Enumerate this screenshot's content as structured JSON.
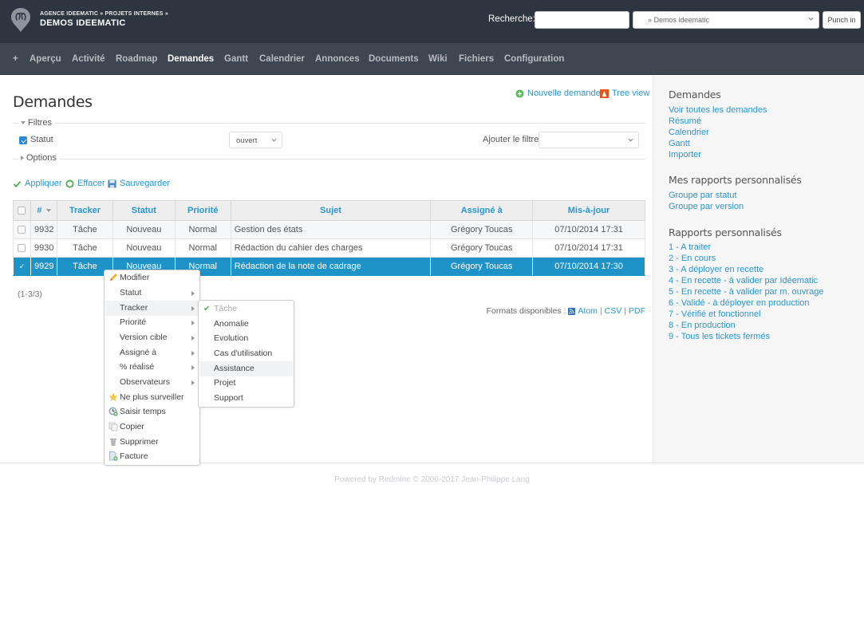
{
  "header": {
    "breadcrumb": "AGENCE IDEEMATIC » PROJETS INTERNES »",
    "project_title": "DEMOS IDEEMATIC",
    "search_label": "Recherche:",
    "search_value": "",
    "project_select_value": "» Demos ideematic",
    "punch_in_label": "Punch in"
  },
  "menu": {
    "items": [
      {
        "label": "+",
        "active": false
      },
      {
        "label": "Aperçu",
        "active": false
      },
      {
        "label": "Activité",
        "active": false
      },
      {
        "label": "Roadmap",
        "active": false
      },
      {
        "label": "Demandes",
        "active": true
      },
      {
        "label": "Gantt",
        "active": false
      },
      {
        "label": "Calendrier",
        "active": false
      },
      {
        "label": "Annonces",
        "active": false
      },
      {
        "label": "Documents",
        "active": false
      },
      {
        "label": "Wiki",
        "active": false
      },
      {
        "label": "Fichiers",
        "active": false
      },
      {
        "label": "Configuration",
        "active": false
      }
    ]
  },
  "content": {
    "title": "Demandes",
    "new_issue_label": "Nouvelle demande",
    "tree_view_label": "Tree view",
    "filters_legend": "Filtres",
    "options_legend": "Options",
    "status_filter": {
      "label": "Statut",
      "checked": true,
      "operator": "ouvert"
    },
    "add_filter_label": "Ajouter le filtre",
    "add_filter_value": "",
    "actions": {
      "apply": "Appliquer",
      "clear": "Effacer",
      "save": "Sauvegarder"
    },
    "pagination": "(1-3/3)",
    "formats_label": "Formats disponibles :",
    "formats": [
      "Atom",
      "CSV",
      "PDF"
    ]
  },
  "table": {
    "columns": [
      "#",
      "Tracker",
      "Statut",
      "Priorité",
      "Sujet",
      "Assigné à",
      "Mis-à-jour"
    ],
    "rows": [
      {
        "id": "9932",
        "tracker": "Tâche",
        "status": "Nouveau",
        "priority": "Normal",
        "subject": "Gestion des états",
        "assignee": "Grégory Toucas",
        "updated": "07/10/2014 17:31",
        "selected": false
      },
      {
        "id": "9930",
        "tracker": "Tâche",
        "status": "Nouveau",
        "priority": "Normal",
        "subject": "Rédaction du cahier des charges",
        "assignee": "Grégory Toucas",
        "updated": "07/10/2014 17:31",
        "selected": false
      },
      {
        "id": "9929",
        "tracker": "Tâche",
        "status": "Nouveau",
        "priority": "Normal",
        "subject": "Rédaction de la note de cadrage",
        "assignee": "Grégory Toucas",
        "updated": "07/10/2014 17:30",
        "selected": true
      }
    ]
  },
  "context_menu": {
    "items": [
      {
        "label": "Modifier",
        "icon": "pencil-icon",
        "submenu": false
      },
      {
        "label": "Statut",
        "icon": null,
        "submenu": true
      },
      {
        "label": "Tracker",
        "icon": null,
        "submenu": true,
        "hover": true
      },
      {
        "label": "Priorité",
        "icon": null,
        "submenu": true
      },
      {
        "label": "Version cible",
        "icon": null,
        "submenu": true
      },
      {
        "label": "Assigné à",
        "icon": null,
        "submenu": true
      },
      {
        "label": "% réalisé",
        "icon": null,
        "submenu": true
      },
      {
        "label": "Observateurs",
        "icon": null,
        "submenu": true
      },
      {
        "label": "Ne plus surveiller",
        "icon": "star-icon",
        "submenu": false
      },
      {
        "label": "Saisir temps",
        "icon": "clock-add-icon",
        "submenu": false
      },
      {
        "label": "Copier",
        "icon": "copy-icon",
        "submenu": false
      },
      {
        "label": "Supprimer",
        "icon": "trash-icon",
        "submenu": false
      },
      {
        "label": "Facture",
        "icon": "invoice-icon",
        "submenu": false
      }
    ],
    "tracker_submenu": [
      {
        "label": "Tâche",
        "current": true
      },
      {
        "label": "Anomalie",
        "current": false
      },
      {
        "label": "Evolution",
        "current": false
      },
      {
        "label": "Cas d'utilisation",
        "current": false
      },
      {
        "label": "Assistance",
        "current": false,
        "hover": true
      },
      {
        "label": "Projet",
        "current": false
      },
      {
        "label": "Support",
        "current": false
      }
    ]
  },
  "sidebar": {
    "issues_heading": "Demandes",
    "issues_links": [
      "Voir toutes les demandes",
      "Résumé",
      "Calendrier",
      "Gantt",
      "Importer"
    ],
    "my_reports_heading": "Mes rapports personnalisés",
    "my_reports_links": [
      "Groupe par statut",
      "Groupe par version"
    ],
    "reports_heading": "Rapports personnalisés",
    "reports_links": [
      "1 - A traiter",
      "2 - En cours",
      "3 - A déployer en recette",
      "4 - En recette - à valider par Idéematic",
      "5 - En recette - à valider par m. ouvrage",
      "6 - Validé - à déployer en production",
      "7 - Vérifié et fonctionnel",
      "8 - En production",
      "9 - Tous les tickets fermés"
    ]
  },
  "footer": {
    "text": "Powered by Redmine © 2006-2017 Jean-Philippe Lang"
  },
  "colors": {
    "header_bg": "#2c3540",
    "menu_bg": "#3e4651",
    "link": "#2996cc",
    "selected_row": "#1e93c8"
  }
}
